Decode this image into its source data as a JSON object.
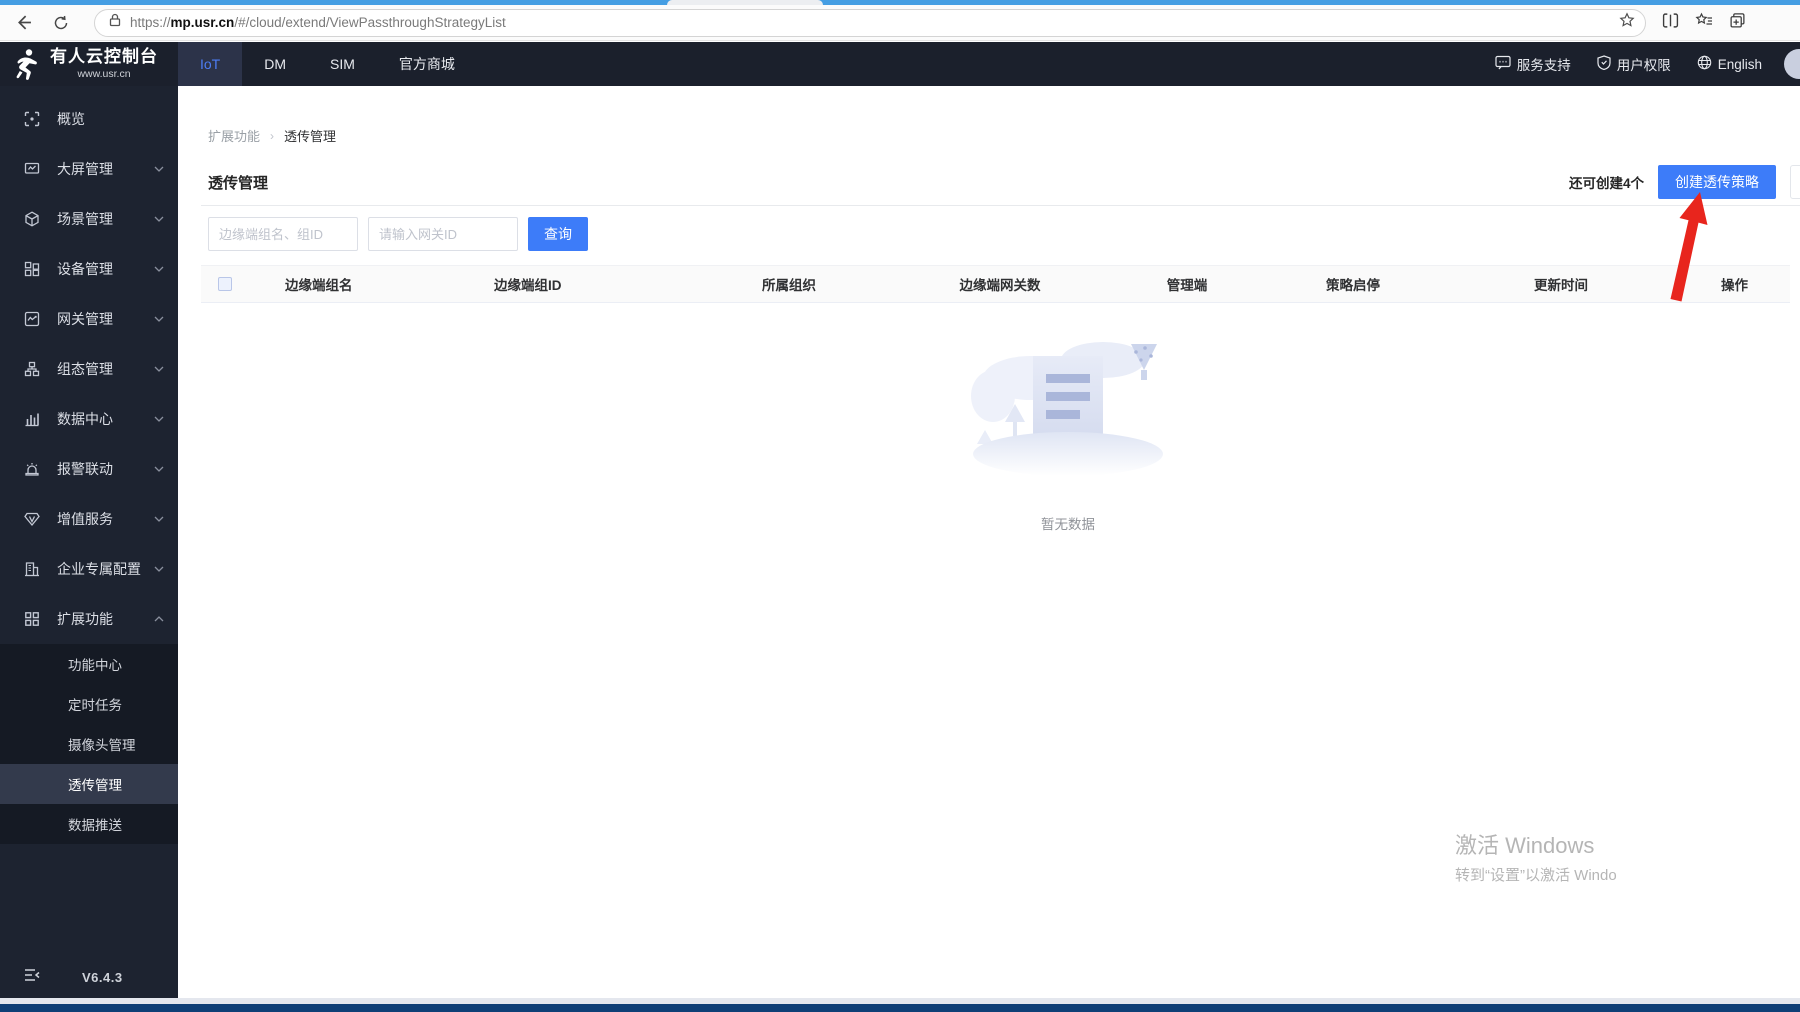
{
  "browser": {
    "url_prefix": "https://",
    "url_domain": "mp.usr.cn",
    "url_path": "/#/cloud/extend/ViewPassthroughStrategyList"
  },
  "header": {
    "logo_title": "有人云控制台",
    "logo_subtitle": "www.usr.cn",
    "tabs": [
      {
        "label": "IoT"
      },
      {
        "label": "DM"
      },
      {
        "label": "SIM"
      },
      {
        "label": "官方商城"
      }
    ],
    "actions": [
      {
        "label": "服务支持",
        "icon": "chat-icon"
      },
      {
        "label": "用户权限",
        "icon": "shield-icon"
      },
      {
        "label": "English",
        "icon": "globe-icon"
      }
    ]
  },
  "sidebar": {
    "items": [
      {
        "label": "概览",
        "icon": "overview-icon"
      },
      {
        "label": "大屏管理",
        "icon": "bigscreen-icon"
      },
      {
        "label": "场景管理",
        "icon": "scene-icon"
      },
      {
        "label": "设备管理",
        "icon": "device-icon"
      },
      {
        "label": "网关管理",
        "icon": "gateway-icon"
      },
      {
        "label": "组态管理",
        "icon": "scada-icon"
      },
      {
        "label": "数据中心",
        "icon": "datacenter-icon"
      },
      {
        "label": "报警联动",
        "icon": "alarm-icon"
      },
      {
        "label": "增值服务",
        "icon": "vas-icon"
      },
      {
        "label": "企业专属配置",
        "icon": "enterprise-icon"
      },
      {
        "label": "扩展功能",
        "icon": "extend-icon"
      }
    ],
    "submenu": [
      {
        "label": "功能中心"
      },
      {
        "label": "定时任务"
      },
      {
        "label": "摄像头管理"
      },
      {
        "label": "透传管理"
      },
      {
        "label": "数据推送"
      }
    ],
    "version": "V6.4.3"
  },
  "main": {
    "breadcrumb": {
      "parent": "扩展功能",
      "current": "透传管理"
    },
    "page_title": "透传管理",
    "quota_text": "还可创建4个",
    "create_button": "创建透传策略",
    "search": {
      "group_placeholder": "边缘端组名、组ID",
      "gateway_placeholder": "请输入网关ID",
      "query_button": "查询"
    },
    "table": {
      "columns": [
        "边缘端组名",
        "边缘端组ID",
        "所属组织",
        "边缘端网关数",
        "管理端",
        "策略启停",
        "更新时间",
        "操作"
      ],
      "rows": []
    },
    "empty_text": "暂无数据"
  },
  "watermark": {
    "line1": "激活 Windows",
    "line2": "转到“设置”以激活 Windo"
  },
  "colors": {
    "accent": "#3d7cf9",
    "header_bg": "#1b202c",
    "sidebar_bg": "#1d2330",
    "active_tab_text": "#4d7df5",
    "annotation_arrow": "#e8251d",
    "taskbar_edge": "#0f3f76"
  }
}
